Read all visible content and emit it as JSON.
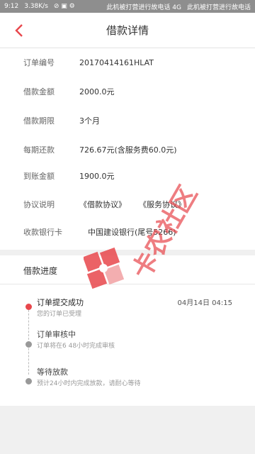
{
  "status_bar": {
    "time": "9:12",
    "speed": "3.38K/s",
    "carrier1": "此机被打营进行故电话 4G",
    "carrier2": "此机被打营进行故电话"
  },
  "header": {
    "title": "借款详情"
  },
  "details": [
    {
      "label": "订单编号",
      "value": "20170414161HLAT"
    },
    {
      "label": "借款金额",
      "value": "2000.0元"
    },
    {
      "label": "借款期限",
      "value": "3个月"
    },
    {
      "label": "每期还款",
      "value": "726.67元(含服务费60.0元)"
    },
    {
      "label": "到账金额",
      "value": "1900.0元"
    },
    {
      "label": "协议说明",
      "link1": "《借款协议》",
      "link2": "《服务协议》"
    },
    {
      "label": "收款银行卡",
      "value": "中国建设银行(尾号5266)"
    }
  ],
  "progress": {
    "title": "借款进度",
    "steps": [
      {
        "title": "订单提交成功",
        "desc": "您的订单已受理",
        "time": "04月14日  04:15"
      },
      {
        "title": "订单审核中",
        "desc": "订单将在6  48小时完成审核"
      },
      {
        "title": "等待放款",
        "desc": "预计24小时内完成放款，请耐心等待"
      }
    ]
  },
  "watermark": {
    "text": "卡农社区"
  },
  "colors": {
    "accent": "#e8474c",
    "link": "#4a8be0"
  }
}
